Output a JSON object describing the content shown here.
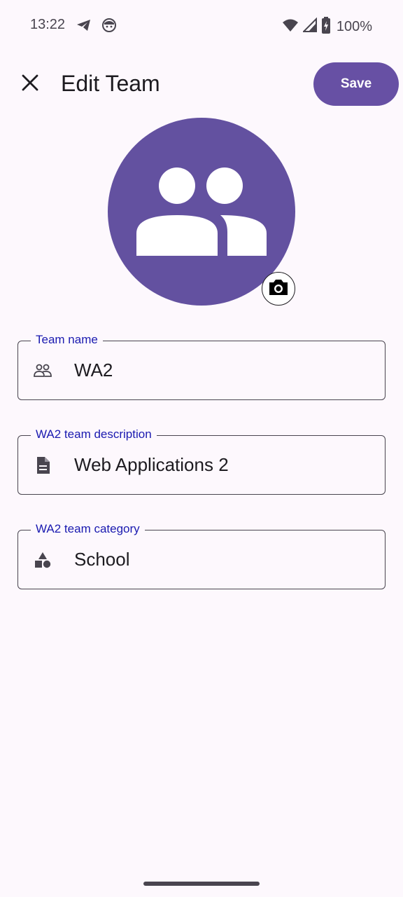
{
  "status_bar": {
    "time": "13:22",
    "left_icons": [
      "telegram-icon",
      "face-icon"
    ],
    "right_icons": [
      "wifi-icon",
      "signal-icon",
      "battery-charging-icon"
    ],
    "battery_text": "100%"
  },
  "header": {
    "title": "Edit Team",
    "close_icon": "close-icon",
    "save_label": "Save"
  },
  "avatar": {
    "icon": "group-icon",
    "camera_icon": "camera-icon",
    "color": "#6351a0"
  },
  "fields": [
    {
      "label": "Team name",
      "value": "WA2",
      "icon": "group-outline-icon"
    },
    {
      "label": "WA2 team description",
      "value": "Web Applications 2",
      "icon": "description-icon"
    },
    {
      "label": "WA2 team category",
      "value": "School",
      "icon": "category-icon"
    }
  ],
  "colors": {
    "accent": "#6750a4",
    "label": "#1a1ab0",
    "background": "#fdf8fd"
  }
}
